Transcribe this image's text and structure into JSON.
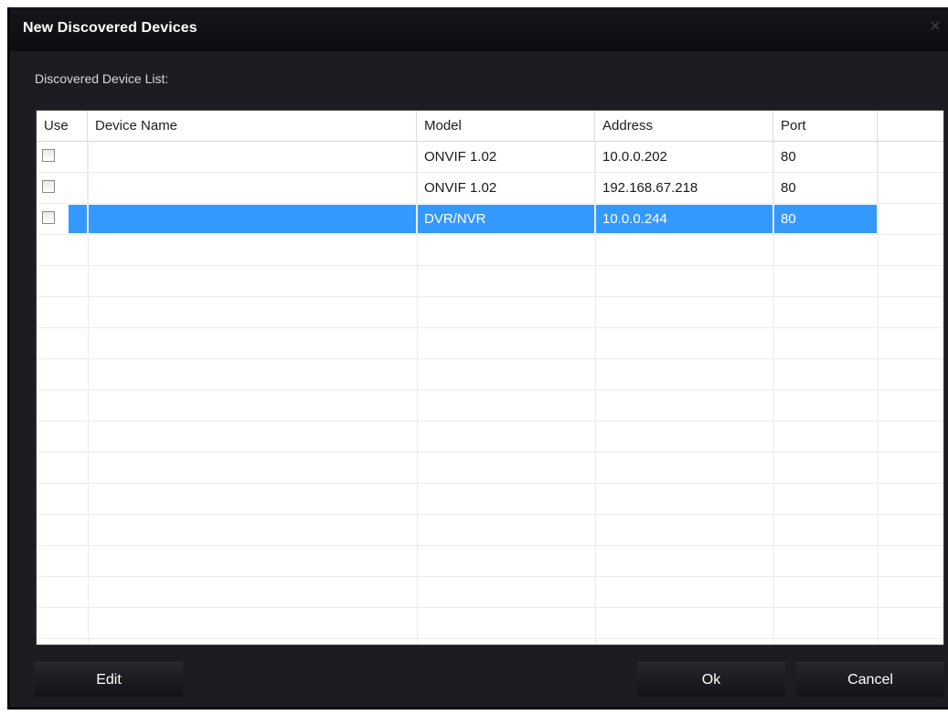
{
  "dialog": {
    "title": "New Discovered Devices",
    "close_glyph": "×",
    "list_label": "Discovered Device List:"
  },
  "table": {
    "columns": [
      "Use",
      "Device Name",
      "Model",
      "Address",
      "Port"
    ],
    "rows": [
      {
        "use": false,
        "device_name": "",
        "model": "ONVIF 1.02",
        "address": "10.0.0.202",
        "port": "80",
        "selected": false
      },
      {
        "use": false,
        "device_name": "",
        "model": "ONVIF 1.02",
        "address": "192.168.67.218",
        "port": "80",
        "selected": false
      },
      {
        "use": false,
        "device_name": "",
        "model": "DVR/NVR",
        "address": "10.0.0.244",
        "port": "80",
        "selected": true
      }
    ]
  },
  "buttons": {
    "edit": "Edit",
    "ok": "Ok",
    "cancel": "Cancel"
  },
  "colors": {
    "selection": "#3399ff",
    "window_bg": "#1c1d22"
  }
}
